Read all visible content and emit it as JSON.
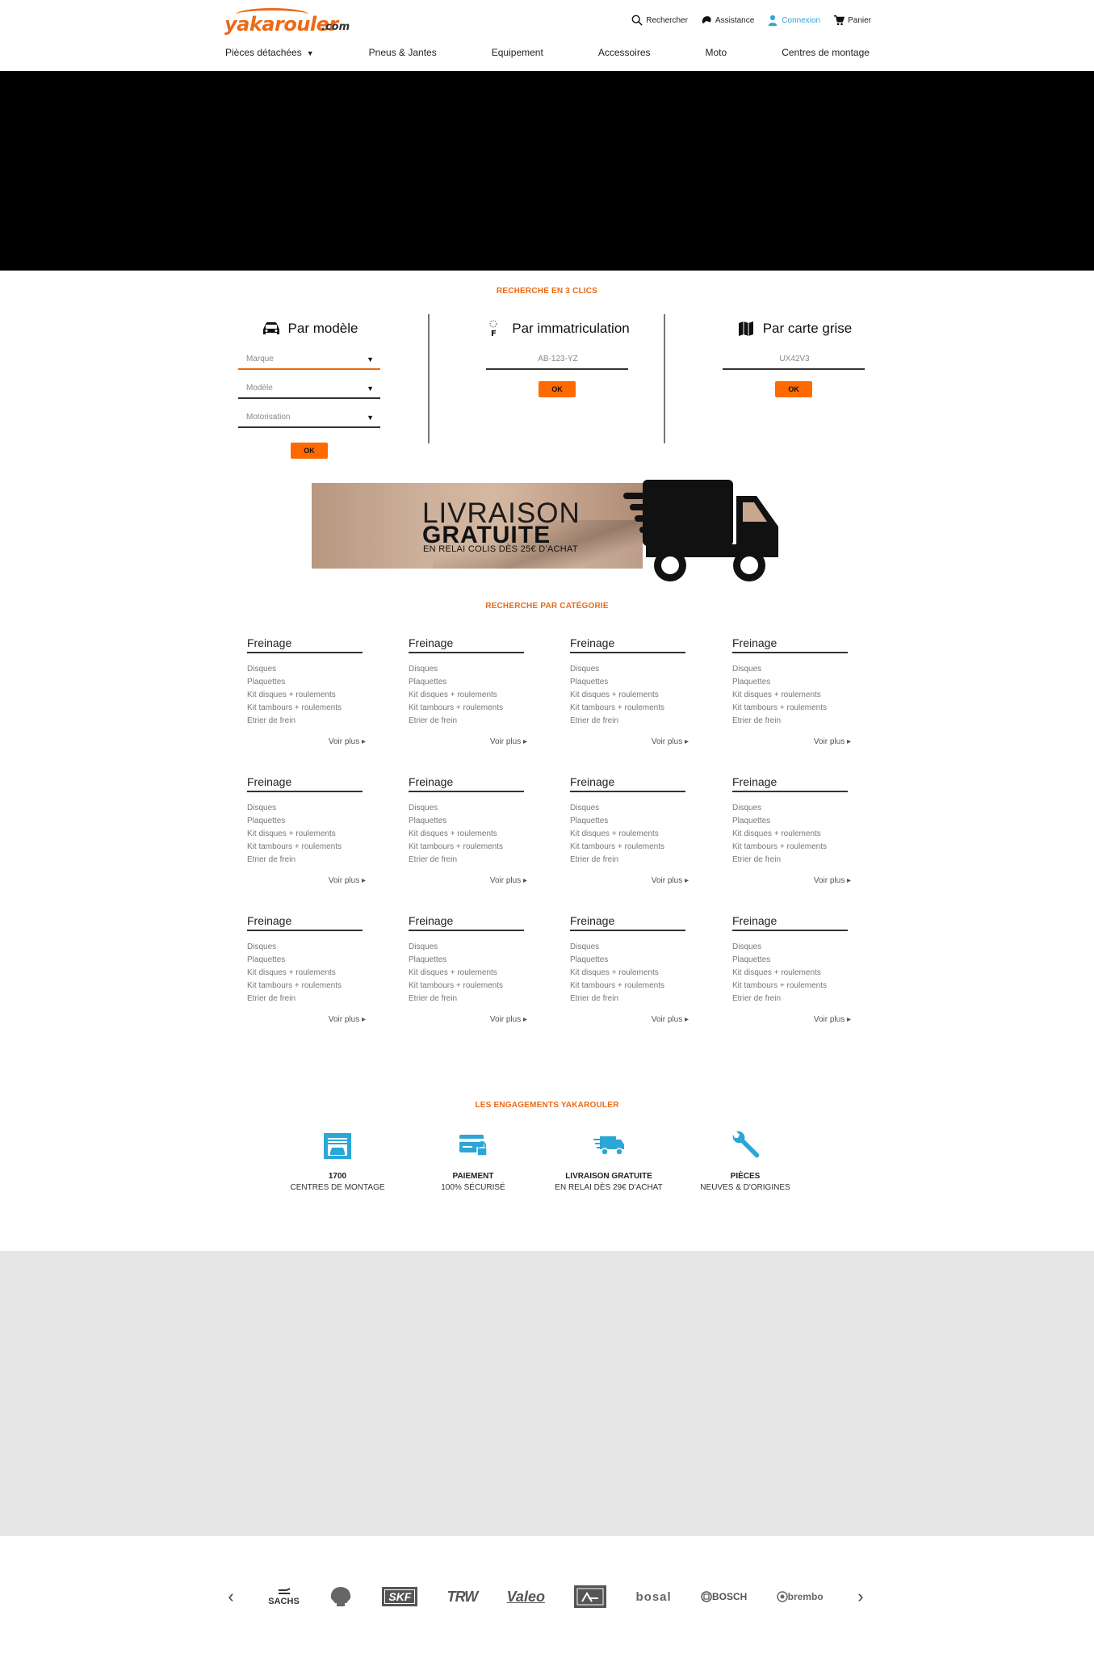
{
  "header": {
    "logo_brand": "yakarouler",
    "logo_tld": ".com",
    "top_links": [
      {
        "label": "Rechercher",
        "icon": "search-icon"
      },
      {
        "label": "Assistance",
        "icon": "assistance-icon"
      },
      {
        "label": "Connexion",
        "icon": "user-icon"
      },
      {
        "label": "Panier",
        "icon": "cart-icon"
      }
    ],
    "nav": [
      "Pièces détachées",
      "Pneus & Jantes",
      "Equipement",
      "Accessoires",
      "Moto",
      "Centres de montage"
    ]
  },
  "search": {
    "section_title": "RECHERCHE EN 3 CLICS",
    "by_model": {
      "title": "Par modèle",
      "fields": [
        "Marque",
        "Modèle",
        "Motorisation"
      ],
      "ok": "OK"
    },
    "by_plate": {
      "title": "Par immatriculation",
      "placeholder": "AB-123-YZ",
      "ok": "OK"
    },
    "by_card": {
      "title": "Par carte grise",
      "placeholder": "UX42V3",
      "ok": "OK"
    }
  },
  "banner": {
    "line1": "LIVRAISON",
    "line2": "GRATUITE",
    "line3": "EN RELAI COLIS DÈS 25€ D'ACHAT"
  },
  "categories": {
    "section_title": "RECHERCHE PAR CATÉGORIE",
    "cards": [
      {
        "title": "Freinage",
        "items": [
          "Disques",
          "Plaquettes",
          "Kit disques + roulements",
          "Kit tambours + roulements",
          "Etrier de frein"
        ],
        "more": "Voir plus ▸"
      },
      {
        "title": "Freinage",
        "items": [
          "Disques",
          "Plaquettes",
          "Kit disques + roulements",
          "Kit tambours + roulements",
          "Etrier de frein"
        ],
        "more": "Voir plus ▸"
      },
      {
        "title": "Freinage",
        "items": [
          "Disques",
          "Plaquettes",
          "Kit disques + roulements",
          "Kit tambours + roulements",
          "Etrier de frein"
        ],
        "more": "Voir plus ▸"
      },
      {
        "title": "Freinage",
        "items": [
          "Disques",
          "Plaquettes",
          "Kit disques + roulements",
          "Kit tambours + roulements",
          "Etrier de frein"
        ],
        "more": "Voir plus ▸"
      },
      {
        "title": "Freinage",
        "items": [
          "Disques",
          "Plaquettes",
          "Kit disques + roulements",
          "Kit tambours + roulements",
          "Etrier de frein"
        ],
        "more": "Voir plus ▸"
      },
      {
        "title": "Freinage",
        "items": [
          "Disques",
          "Plaquettes",
          "Kit disques + roulements",
          "Kit tambours + roulements",
          "Etrier de frein"
        ],
        "more": "Voir plus ▸"
      },
      {
        "title": "Freinage",
        "items": [
          "Disques",
          "Plaquettes",
          "Kit disques + roulements",
          "Kit tambours + roulements",
          "Etrier de frein"
        ],
        "more": "Voir plus ▸"
      },
      {
        "title": "Freinage",
        "items": [
          "Disques",
          "Plaquettes",
          "Kit disques + roulements",
          "Kit tambours + roulements",
          "Etrier de frein"
        ],
        "more": "Voir plus ▸"
      },
      {
        "title": "Freinage",
        "items": [
          "Disques",
          "Plaquettes",
          "Kit disques + roulements",
          "Kit tambours + roulements",
          "Etrier de frein"
        ],
        "more": "Voir plus ▸"
      },
      {
        "title": "Freinage",
        "items": [
          "Disques",
          "Plaquettes",
          "Kit disques + roulements",
          "Kit tambours + roulements",
          "Etrier de frein"
        ],
        "more": "Voir plus ▸"
      },
      {
        "title": "Freinage",
        "items": [
          "Disques",
          "Plaquettes",
          "Kit disques + roulements",
          "Kit tambours + roulements",
          "Etrier de frein"
        ],
        "more": "Voir plus ▸"
      },
      {
        "title": "Freinage",
        "items": [
          "Disques",
          "Plaquettes",
          "Kit disques + roulements",
          "Kit tambours + roulements",
          "Etrier de frein"
        ],
        "more": "Voir plus ▸"
      }
    ]
  },
  "engagements": {
    "section_title": "LES ENGAGEMENTS YAKAROULER",
    "items": [
      {
        "line1": "1700",
        "line2": "CENTRES DE MONTAGE",
        "icon": "garage-icon"
      },
      {
        "line1": "PAIEMENT",
        "line2": "100% SÉCURISÉ",
        "icon": "secure-card-icon"
      },
      {
        "line1": "LIVRAISON GRATUITE",
        "line2": "EN RELAI DÈS 29€ D'ACHAT",
        "icon": "delivery-truck-icon"
      },
      {
        "line1": "PIÈCES",
        "line2": "NEUVES & D'ORIGINES",
        "icon": "wrench-icon"
      }
    ],
    "accent_color": "#2aa7d6"
  },
  "brands": {
    "prev": "‹",
    "next": "›",
    "logos": [
      "SACHS",
      "",
      "SKF",
      "TRW",
      "Valeo",
      "",
      "bosal",
      "BOSCH",
      "brembo"
    ]
  },
  "colors": {
    "accent": "#ec6a16",
    "button": "#ff6a00",
    "link_active": "#2aa7d6",
    "grey_band": "#e6e6e6"
  }
}
